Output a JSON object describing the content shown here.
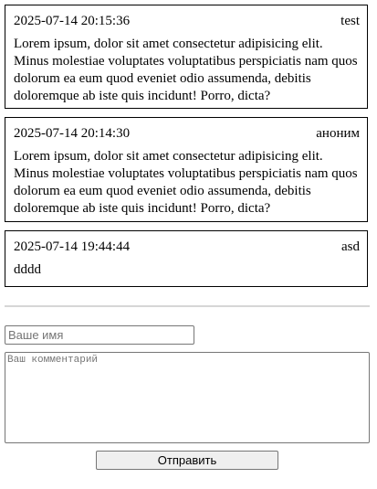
{
  "comments": [
    {
      "datetime": "2025-07-14 20:15:36",
      "author": "test",
      "text": "Lorem ipsum, dolor sit amet consectetur adipisicing elit. Minus molestiae voluptates voluptatibus perspiciatis nam quos dolorum ea eum quod eveniet odio assumenda, debitis doloremque ab iste quis incidunt! Porro, dicta?"
    },
    {
      "datetime": "2025-07-14 20:14:30",
      "author": "аноним",
      "text": "Lorem ipsum, dolor sit amet consectetur adipisicing elit. Minus molestiae voluptates voluptatibus perspiciatis nam quos dolorum ea eum quod eveniet odio assumenda, debitis doloremque ab iste quis incidunt! Porro, dicta?"
    },
    {
      "datetime": "2025-07-14 19:44:44",
      "author": "asd",
      "text": "dddd"
    }
  ],
  "form": {
    "name_placeholder": "Ваше имя",
    "name_value": "",
    "comment_placeholder": "Ваш комментарий",
    "comment_value": "",
    "submit_label": "Отправить"
  }
}
